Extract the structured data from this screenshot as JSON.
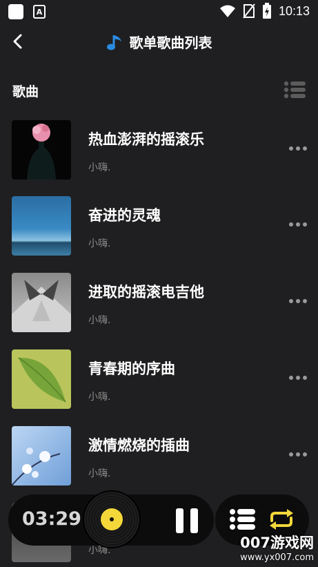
{
  "status_bar": {
    "time": "10:13",
    "notification_icon_letter": "A"
  },
  "header": {
    "title": "歌单歌曲列表"
  },
  "section": {
    "label": "歌曲"
  },
  "songs": [
    {
      "title": "热血澎湃的摇滚乐",
      "artist": "小嗨."
    },
    {
      "title": "奋进的灵魂",
      "artist": "小嗨."
    },
    {
      "title": "进取的摇滚电吉他",
      "artist": "小嗨."
    },
    {
      "title": "青春期的序曲",
      "artist": "小嗨."
    },
    {
      "title": "激情燃烧的插曲",
      "artist": "小嗨."
    },
    {
      "title": "",
      "artist": "小嗨."
    }
  ],
  "player": {
    "elapsed": "03:29",
    "disc_color": "#f4d83a",
    "loop_color": "#f4d83a"
  },
  "watermark": {
    "line1": "007游戏网",
    "line2": "www.yx007.com"
  }
}
